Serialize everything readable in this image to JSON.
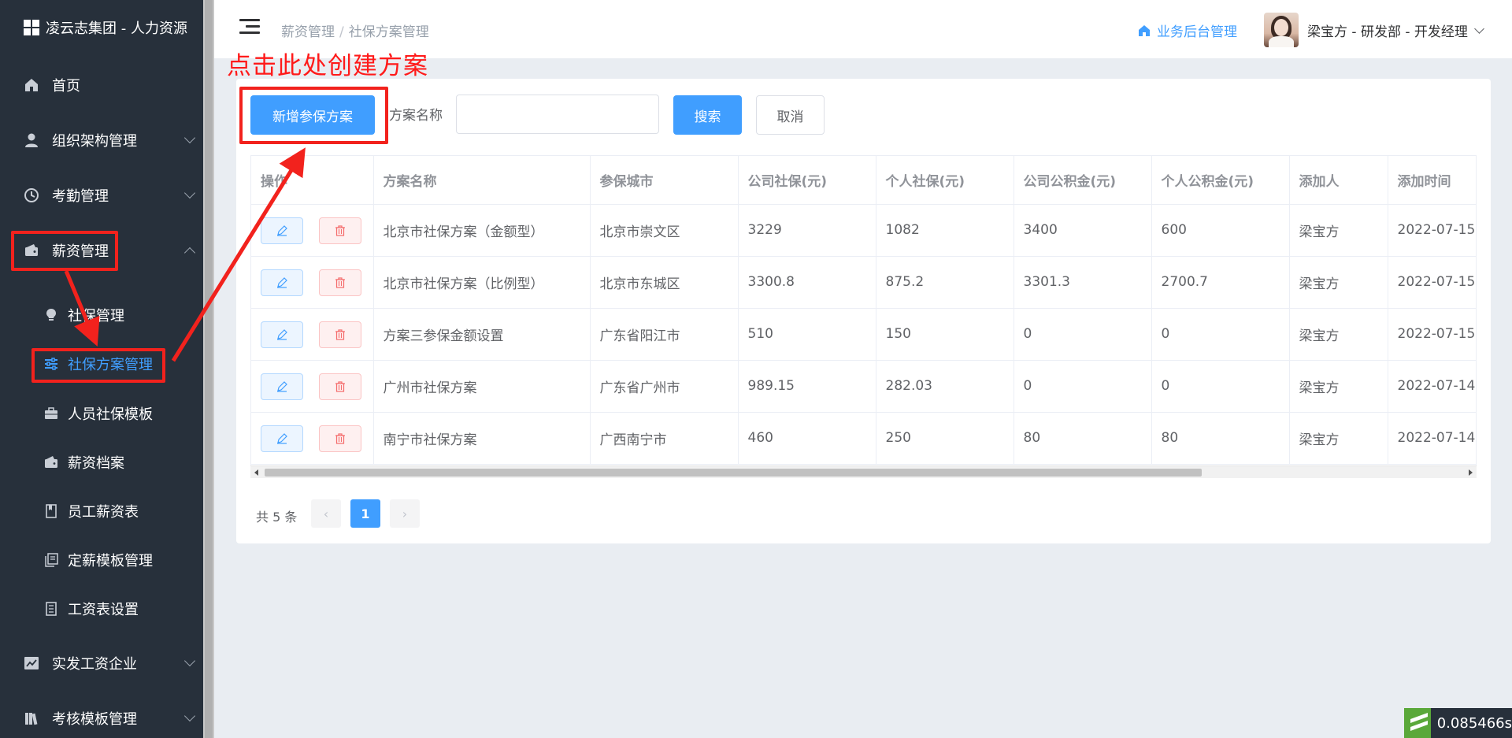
{
  "app": {
    "title": "凌云志集团 - 人力资源"
  },
  "sidebar": {
    "items": [
      {
        "label": "首页",
        "icon": "home-icon"
      },
      {
        "label": "组织架构管理",
        "icon": "user-icon"
      },
      {
        "label": "考勤管理",
        "icon": "clock-icon"
      },
      {
        "label": "薪资管理",
        "icon": "wallet-icon"
      }
    ],
    "sub_items": [
      {
        "label": "社保管理",
        "icon": "bulb-icon"
      },
      {
        "label": "社保方案管理",
        "icon": "sliders-icon"
      },
      {
        "label": "人员社保模板",
        "icon": "briefcase-icon"
      },
      {
        "label": "薪资档案",
        "icon": "wallet-icon"
      },
      {
        "label": "员工薪资表",
        "icon": "notebook-icon"
      },
      {
        "label": "定薪模板管理",
        "icon": "copy-icon"
      },
      {
        "label": "工资表设置",
        "icon": "document-icon"
      }
    ],
    "bottom_items": [
      {
        "label": "实发工资企业",
        "icon": "chart-icon"
      },
      {
        "label": "考核模板管理",
        "icon": "books-icon"
      }
    ]
  },
  "header": {
    "breadcrumb_parent": "薪资管理",
    "breadcrumb_sep": "/",
    "breadcrumb_current": "社保方案管理",
    "biz_link": "业务后台管理",
    "user": "梁宝方 - 研发部 - 开发经理"
  },
  "annotation": {
    "text": "点击此处创建方案"
  },
  "toolbar": {
    "add_label": "新增参保方案",
    "name_label": "方案名称",
    "name_value": "",
    "name_placeholder": "",
    "search_label": "搜索",
    "cancel_label": "取消"
  },
  "table": {
    "columns": [
      "操作",
      "方案名称",
      "参保城市",
      "公司社保(元)",
      "个人社保(元)",
      "公司公积金(元)",
      "个人公积金(元)",
      "添加人",
      "添加时间"
    ],
    "rows": [
      [
        "北京市社保方案（金额型）",
        "北京市崇文区",
        "3229",
        "1082",
        "3400",
        "600",
        "梁宝方",
        "2022-07-15"
      ],
      [
        "北京市社保方案（比例型）",
        "北京市东城区",
        "3300.8",
        "875.2",
        "3301.3",
        "2700.7",
        "梁宝方",
        "2022-07-15"
      ],
      [
        "方案三参保金额设置",
        "广东省阳江市",
        "510",
        "150",
        "0",
        "0",
        "梁宝方",
        "2022-07-15"
      ],
      [
        "广州市社保方案",
        "广东省广州市",
        "989.15",
        "282.03",
        "0",
        "0",
        "梁宝方",
        "2022-07-14"
      ],
      [
        "南宁市社保方案",
        "广西南宁市",
        "460",
        "250",
        "80",
        "80",
        "梁宝方",
        "2022-07-14"
      ]
    ]
  },
  "pagination": {
    "total": "共 5 条",
    "prev": "‹",
    "current": "1",
    "next": "›"
  },
  "perf": {
    "value": "0.085466s"
  },
  "colors": {
    "primary": "#409eff",
    "sidebar": "#27303b",
    "annotation": "#f2221d",
    "danger": "#f56c6c"
  }
}
